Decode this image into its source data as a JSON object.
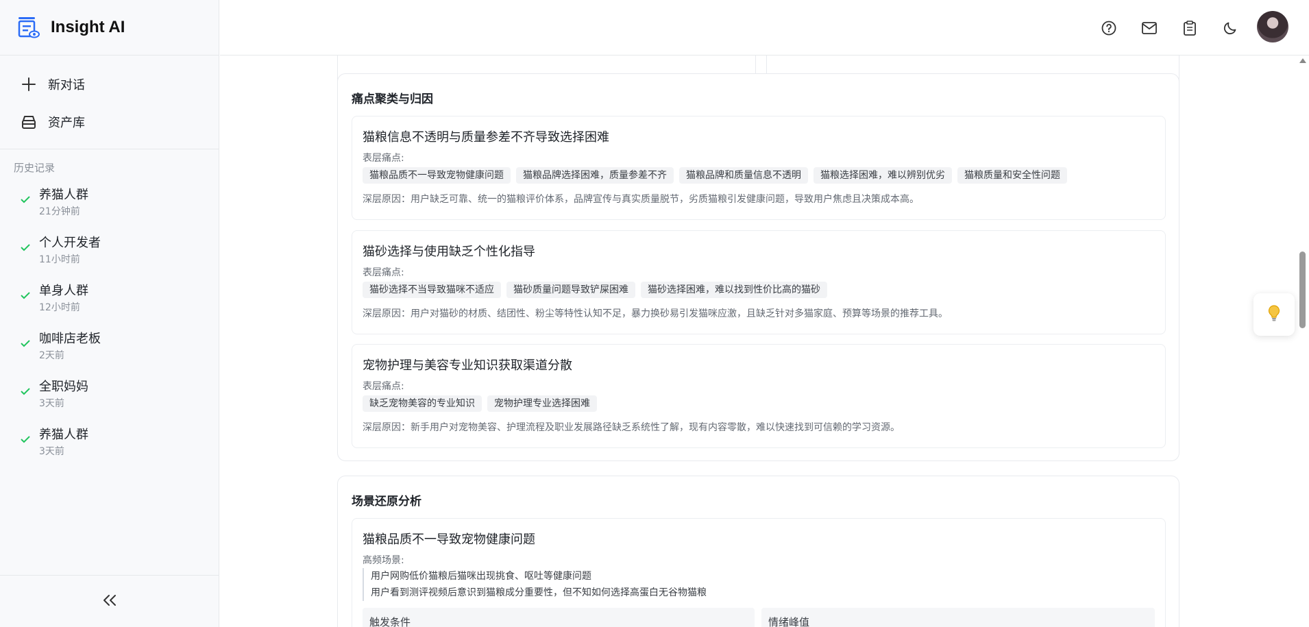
{
  "app": {
    "name": "Insight AI"
  },
  "nav": [
    {
      "label": "新对话",
      "icon": "plus-icon"
    },
    {
      "label": "资产库",
      "icon": "archive-icon"
    }
  ],
  "history": {
    "title": "历史记录",
    "items": [
      {
        "name": "养猫人群",
        "time": "21分钟前"
      },
      {
        "name": "个人开发者",
        "time": "11小时前"
      },
      {
        "name": "单身人群",
        "time": "12小时前"
      },
      {
        "name": "咖啡店老板",
        "time": "2天前"
      },
      {
        "name": "全职妈妈",
        "time": "3天前"
      },
      {
        "name": "养猫人群",
        "time": "3天前"
      }
    ]
  },
  "header": {
    "icons": [
      "help-icon",
      "mail-icon",
      "clipboard-icon",
      "moon-icon"
    ]
  },
  "pain_section": {
    "title": "痛点聚类与归因",
    "clusters": [
      {
        "title": "猫粮信息不透明与质量参差不齐导致选择困难",
        "surface_label": "表层痛点:",
        "tags": [
          "猫粮品质不一导致宠物健康问题",
          "猫粮品牌选择困难，质量参差不齐",
          "猫粮品牌和质量信息不透明",
          "猫粮选择困难，难以辨别优劣",
          "猫粮质量和安全性问题"
        ],
        "reason": "深层原因：用户缺乏可靠、统一的猫粮评价体系，品牌宣传与真实质量脱节，劣质猫粮引发健康问题，导致用户焦虑且决策成本高。"
      },
      {
        "title": "猫砂选择与使用缺乏个性化指导",
        "surface_label": "表层痛点:",
        "tags": [
          "猫砂选择不当导致猫咪不适应",
          "猫砂质量问题导致铲屎困难",
          "猫砂选择困难，难以找到性价比高的猫砂"
        ],
        "reason": "深层原因：用户对猫砂的材质、结团性、粉尘等特性认知不足，暴力换砂易引发猫咪应激，且缺乏针对多猫家庭、预算等场景的推荐工具。"
      },
      {
        "title": "宠物护理与美容专业知识获取渠道分散",
        "surface_label": "表层痛点:",
        "tags": [
          "缺乏宠物美容的专业知识",
          "宠物护理专业选择困难"
        ],
        "reason": "深层原因：新手用户对宠物美容、护理流程及职业发展路径缺乏系统性了解，现有内容零散，难以快速找到可信赖的学习资源。"
      }
    ]
  },
  "scene_section": {
    "title": "场景还原分析",
    "item": {
      "title": "猫粮品质不一导致宠物健康问题",
      "label": "高频场景:",
      "scenes": [
        "用户网购低价猫粮后猫咪出现挑食、呕吐等健康问题",
        "用户看到测评视频后意识到猫粮成分重要性，但不知如何选择高蛋白无谷物猫粮"
      ],
      "trigger_label": "触发条件",
      "emotion_label": "情绪峰值"
    }
  },
  "colors": {
    "accent": "#2b6cf6",
    "check": "#22c55e",
    "tip": "#f5a623"
  }
}
